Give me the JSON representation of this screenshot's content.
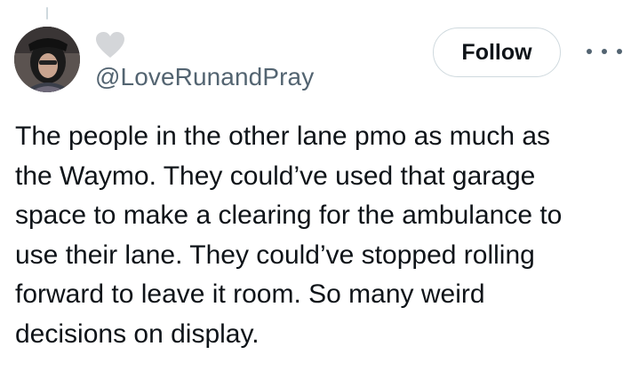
{
  "author": {
    "handle": "@LoveRunandPray",
    "avatar_description": "profile-photo",
    "name_icon": "heart-icon"
  },
  "actions": {
    "follow_label": "Follow",
    "more_icon": "more-horizontal-icon"
  },
  "tweet": {
    "lines": [
      "The people in the other lane pmo as much as",
      "the Waymo. They could’ve used that garage",
      "space to make a clearing for the ambulance to",
      "use their lane. They could’ve stopped rolling",
      "forward to leave it room. So many weird",
      "decisions on display."
    ]
  },
  "colors": {
    "text_primary": "#0f1419",
    "text_secondary": "#536471",
    "border": "#cfd9de",
    "heart_fill": "#d4d6d9"
  }
}
